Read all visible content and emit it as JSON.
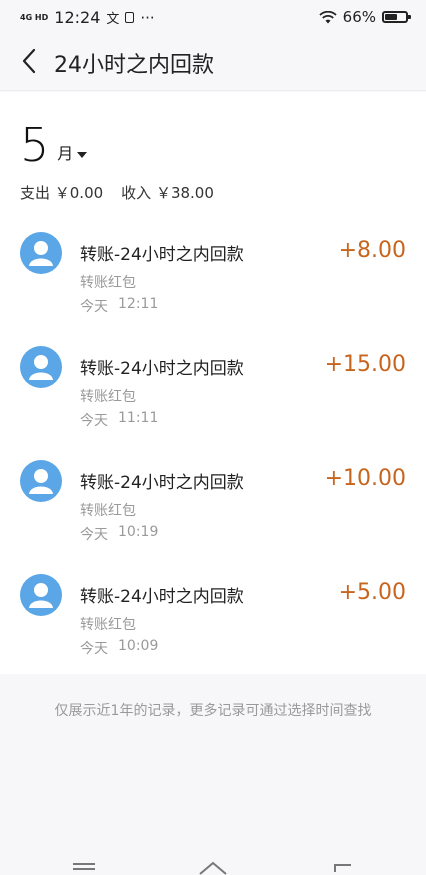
{
  "status_bar": {
    "network": "4G HD",
    "time": "12:24",
    "notification_icons": [
      "translate-icon",
      "sim-icon"
    ],
    "more": "···",
    "battery": "66%",
    "battery_level": 0.66
  },
  "header": {
    "title": "24小时之内回款"
  },
  "filter": {
    "month": "5",
    "month_unit": "月"
  },
  "summary": {
    "expense": "支出 ￥0.00",
    "income": "收入 ￥38.00"
  },
  "transactions": [
    {
      "title": "转账-24小时之内回款",
      "category": "转账红包",
      "day": "今天",
      "time": "12:11",
      "amount": "+8.00"
    },
    {
      "title": "转账-24小时之内回款",
      "category": "转账红包",
      "day": "今天",
      "time": "11:11",
      "amount": "+15.00"
    },
    {
      "title": "转账-24小时之内回款",
      "category": "转账红包",
      "day": "今天",
      "time": "10:19",
      "amount": "+10.00"
    },
    {
      "title": "转账-24小时之内回款",
      "category": "转账红包",
      "day": "今天",
      "time": "10:09",
      "amount": "+5.00"
    }
  ],
  "footer_note": "仅展示近1年的记录，更多记录可通过选择时间查找",
  "colors": {
    "amount": "#c7651f",
    "avatar": "#5aa6e6",
    "background": "#f7f6f8"
  }
}
